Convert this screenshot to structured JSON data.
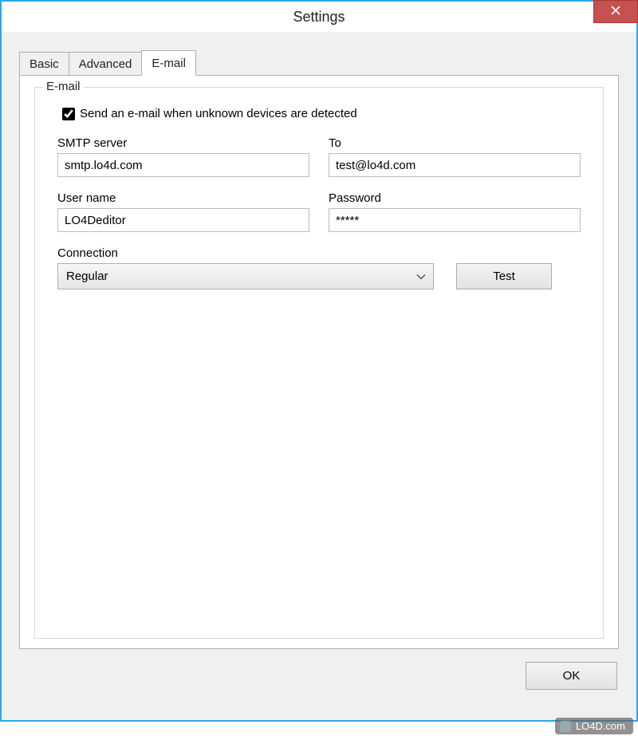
{
  "window": {
    "title": "Settings"
  },
  "tabs": {
    "basic": "Basic",
    "advanced": "Advanced",
    "email": "E-mail"
  },
  "group": {
    "legend": "E-mail",
    "checkbox_label": "Send an e-mail when unknown devices are detected",
    "checkbox_checked": true
  },
  "fields": {
    "smtp_label": "SMTP server",
    "smtp_value": "smtp.lo4d.com",
    "to_label": "To",
    "to_value": "test@lo4d.com",
    "username_label": "User name",
    "username_value": "LO4Deditor",
    "password_label": "Password",
    "password_value": "*****",
    "connection_label": "Connection",
    "connection_value": "Regular",
    "test_button": "Test"
  },
  "buttons": {
    "ok": "OK"
  },
  "watermark": "LO4D.com"
}
